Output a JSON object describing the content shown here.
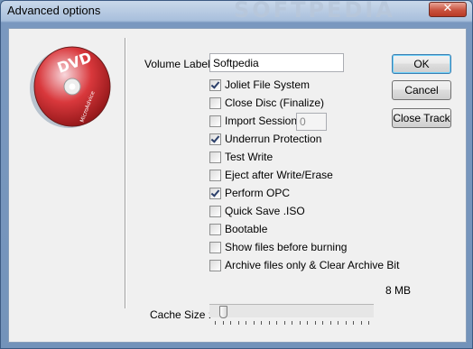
{
  "window": {
    "title": "Advanced options",
    "watermark": "SOFTPEDIA",
    "close_symbol": "✕"
  },
  "disc": {
    "top_text": "DVD",
    "bottom_text": "MicroAdvice"
  },
  "volume": {
    "label": "Volume Label :",
    "value": "Softpedia"
  },
  "checkboxes": [
    {
      "label": "Joliet File System",
      "checked": true
    },
    {
      "label": "Close Disc (Finalize)",
      "checked": false
    },
    {
      "label": "Import Session",
      "checked": false
    },
    {
      "label": "Underrun Protection",
      "checked": true
    },
    {
      "label": "Test Write",
      "checked": false
    },
    {
      "label": "Eject after Write/Erase",
      "checked": false
    },
    {
      "label": "Perform OPC",
      "checked": true
    },
    {
      "label": "Quick Save .ISO",
      "checked": false
    },
    {
      "label": "Bootable",
      "checked": false
    },
    {
      "label": "Show files before burning",
      "checked": false
    },
    {
      "label": "Archive files only & Clear Archive Bit",
      "checked": false
    }
  ],
  "import_session_value": "0",
  "buttons": {
    "ok": "OK",
    "cancel": "Cancel",
    "close_track": "Close Track"
  },
  "cache": {
    "label": "Cache Size :",
    "value_text": "8 MB",
    "slider_fraction": 0.05
  }
}
